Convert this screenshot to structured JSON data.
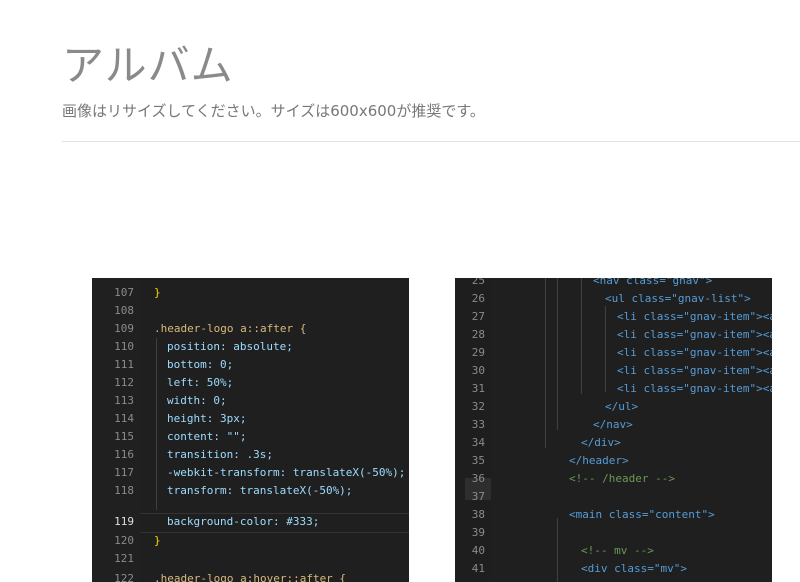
{
  "page": {
    "title": "アルバム",
    "subtitle": "画像はリサイズしてください。サイズは600x600が推奨です。"
  },
  "album": {
    "images": [
      {
        "lines": [
          {
            "n": "107",
            "t": "}"
          },
          {
            "n": "108",
            "t": ""
          },
          {
            "n": "109",
            "t": ".header-logo a::after {"
          },
          {
            "n": "110",
            "t": "position: absolute;"
          },
          {
            "n": "111",
            "t": "bottom: 0;"
          },
          {
            "n": "112",
            "t": "left: 50%;"
          },
          {
            "n": "113",
            "t": "width: 0;"
          },
          {
            "n": "114",
            "t": "height: 3px;"
          },
          {
            "n": "115",
            "t": "content: \"\";"
          },
          {
            "n": "116",
            "t": "transition: .3s;"
          },
          {
            "n": "117",
            "t": "-webkit-transform: translateX(-50%);"
          },
          {
            "n": "118",
            "t": "transform: translateX(-50%);"
          },
          {
            "n": "119",
            "t": "background-color: #333;"
          },
          {
            "n": "120",
            "t": "}"
          },
          {
            "n": "121",
            "t": ""
          },
          {
            "n": "122",
            "t": ".header-logo a:hover::after {"
          }
        ]
      },
      {
        "lines": [
          {
            "n": "25",
            "t": "<nav class=\"gnav\">"
          },
          {
            "n": "26",
            "t": "<ul class=\"gnav-list\">"
          },
          {
            "n": "27",
            "t": "<li class=\"gnav-item\"><a h"
          },
          {
            "n": "28",
            "t": "<li class=\"gnav-item\"><a h"
          },
          {
            "n": "29",
            "t": "<li class=\"gnav-item\"><a h"
          },
          {
            "n": "30",
            "t": "<li class=\"gnav-item\"><a h"
          },
          {
            "n": "31",
            "t": "<li class=\"gnav-item\"><a h"
          },
          {
            "n": "32",
            "t": "</ul>"
          },
          {
            "n": "33",
            "t": "</nav>"
          },
          {
            "n": "34",
            "t": "</div>"
          },
          {
            "n": "35",
            "t": "</header>"
          },
          {
            "n": "36",
            "t": "<!-- /header -->"
          },
          {
            "n": "37",
            "t": ""
          },
          {
            "n": "38",
            "t": "<main class=\"content\">"
          },
          {
            "n": "39",
            "t": ""
          },
          {
            "n": "40",
            "t": "<!-- mv -->"
          },
          {
            "n": "41",
            "t": "<div class=\"mv\">"
          }
        ]
      }
    ]
  },
  "colors": {
    "title": "#8a8a8a",
    "editor_bg": "#1f1f1f",
    "swatch": "#333333"
  }
}
